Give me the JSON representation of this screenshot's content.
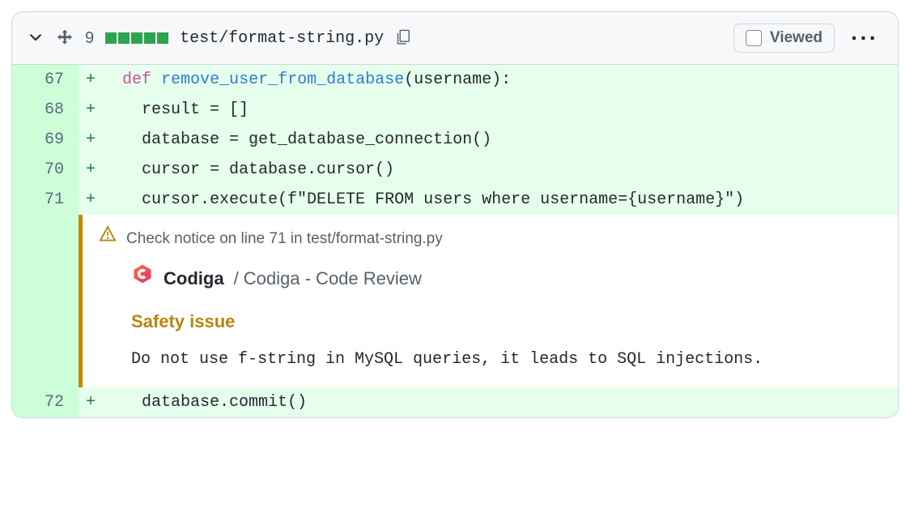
{
  "header": {
    "change_count": "9",
    "filepath": "test/format-string.py",
    "viewed_label": "Viewed"
  },
  "diff": {
    "rows": [
      {
        "n": "67",
        "m": "+",
        "html": "  <span class='kw-def'>def</span> <span class='fn-name'>remove_user_from_database</span>(username):"
      },
      {
        "n": "68",
        "m": "+",
        "html": "    result = []"
      },
      {
        "n": "69",
        "m": "+",
        "html": "    database = get_database_connection()"
      },
      {
        "n": "70",
        "m": "+",
        "html": "    cursor = database.cursor()"
      },
      {
        "n": "71",
        "m": "+",
        "html": "    cursor.execute(<span class='str'>f\"DELETE FROM users where username={username}\"</span>)"
      },
      {
        "n": "72",
        "m": "+",
        "html": "    database.commit()"
      }
    ]
  },
  "annotation": {
    "after_line": "71",
    "notice_text": "Check notice on line 71 in test/format-string.py",
    "brand": "Codiga",
    "brand_suffix": "/ Codiga - Code Review",
    "issue_type": "Safety issue",
    "message": "Do not use f-string in MySQL queries, it leads to SQL injections."
  }
}
